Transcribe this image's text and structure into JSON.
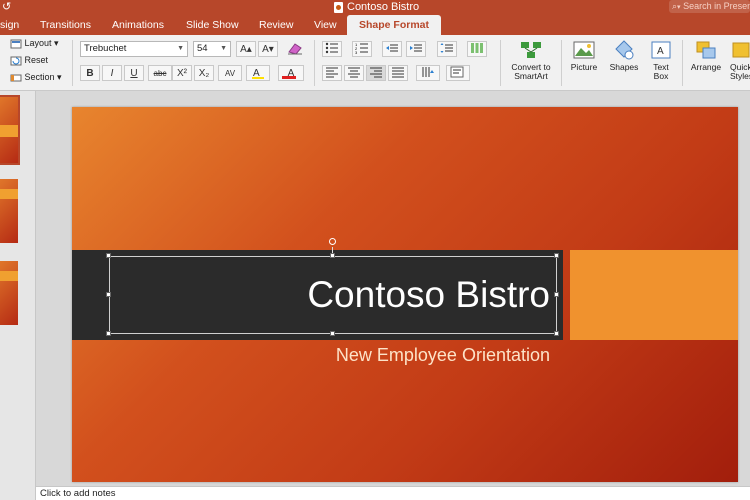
{
  "window": {
    "left_glyphs": "↺",
    "title": "Contoso Bistro",
    "search_placeholder": "Search in Presentation"
  },
  "tabs": [
    {
      "label": "sign"
    },
    {
      "label": "Transitions"
    },
    {
      "label": "Animations"
    },
    {
      "label": "Slide Show"
    },
    {
      "label": "Review"
    },
    {
      "label": "View"
    },
    {
      "label": "Shape Format",
      "active": true
    }
  ],
  "ribbon": {
    "slides_group": {
      "layout": "Layout",
      "reset": "Reset",
      "section": "Section"
    },
    "font": {
      "family": "Trebuchet",
      "size": "54",
      "grow": "A▴",
      "shrink": "A▾",
      "bold": "B",
      "italic": "I",
      "underline": "U",
      "strike": "abc",
      "superscript": "X²",
      "subscript": "X₂",
      "spacing": "AV",
      "font_color": "A"
    },
    "insert_group": {
      "convert_smartart": "Convert to SmartArt",
      "picture": "Picture",
      "shapes": "Shapes",
      "text_box": "Text Box",
      "arrange": "Arrange",
      "quick_styles": "Quick Styles"
    },
    "colors": {
      "accent": "#b7472a",
      "font_color_bar": "#e02020",
      "highlight_bar": "#ffe000",
      "smartart_green": "#3c9a3c"
    }
  },
  "slide": {
    "title": "Contoso Bistro",
    "subtitle": "New Employee Orientation",
    "colors": {
      "band": "#2b2b2b",
      "orange_box": "#f0922e"
    }
  },
  "notes": {
    "placeholder": "Click to add notes"
  },
  "thumbnails": [
    {
      "index": 1,
      "selected": true
    },
    {
      "index": 2,
      "selected": false
    },
    {
      "index": 3,
      "selected": false
    }
  ]
}
